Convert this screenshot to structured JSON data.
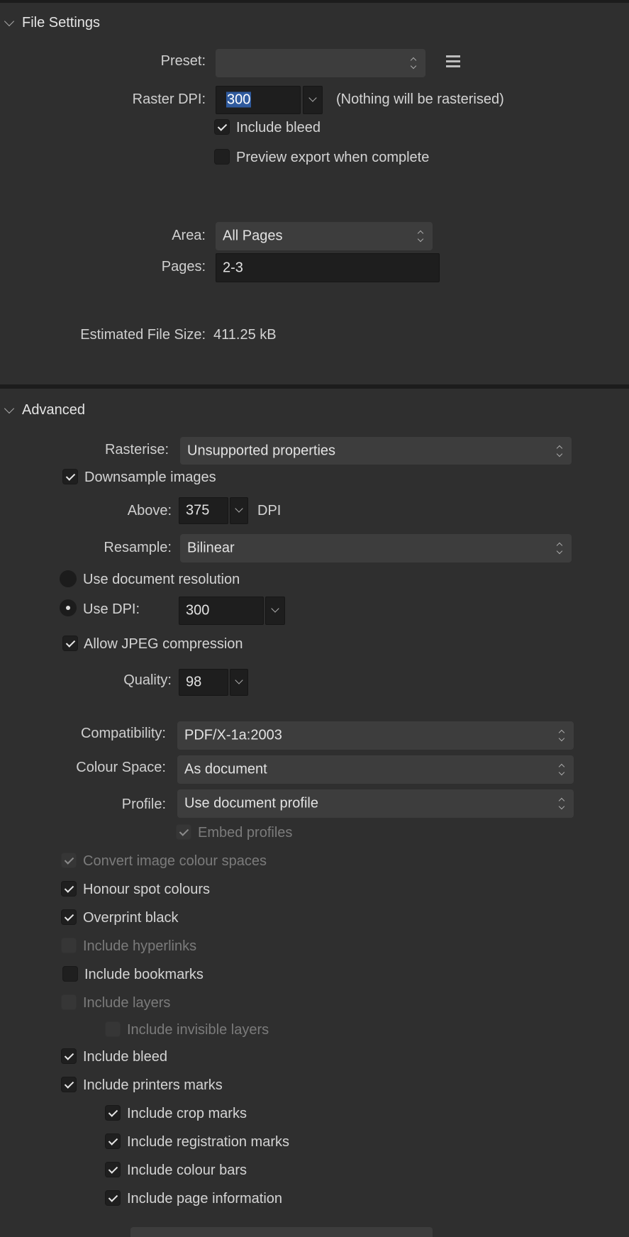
{
  "file_settings": {
    "title": "File Settings",
    "preset_label": "Preset:",
    "preset_value": "",
    "raster_dpi_label": "Raster DPI:",
    "raster_dpi_value": "300",
    "raster_note": "(Nothing will be rasterised)",
    "include_bleed": {
      "label": "Include bleed",
      "checked": true
    },
    "preview_export": {
      "label": "Preview export when complete",
      "checked": false
    },
    "area_label": "Area:",
    "area_value": "All Pages",
    "pages_label": "Pages:",
    "pages_value": "2-3",
    "estimated_label": "Estimated File Size:",
    "estimated_value": "411.25 kB"
  },
  "advanced": {
    "title": "Advanced",
    "rasterise_label": "Rasterise:",
    "rasterise_value": "Unsupported properties",
    "downsample": {
      "label": "Downsample images",
      "checked": true
    },
    "above_label": "Above:",
    "above_value": "375",
    "above_unit": "DPI",
    "resample_label": "Resample:",
    "resample_value": "Bilinear",
    "use_doc_res": {
      "label": "Use document resolution",
      "selected": false
    },
    "use_dpi": {
      "label": "Use DPI:",
      "selected": true,
      "value": "300"
    },
    "allow_jpeg": {
      "label": "Allow JPEG compression",
      "checked": true
    },
    "quality_label": "Quality:",
    "quality_value": "98",
    "compat_label": "Compatibility:",
    "compat_value": "PDF/X-1a:2003",
    "colour_space_label": "Colour Space:",
    "colour_space_value": "As document",
    "profile_label": "Profile:",
    "profile_value": "Use document profile",
    "embed_profiles": {
      "label": "Embed profiles",
      "checked": true,
      "disabled": true
    },
    "convert_colour": {
      "label": "Convert image colour spaces",
      "checked": true,
      "disabled": true
    },
    "honour_spot": {
      "label": "Honour spot colours",
      "checked": true
    },
    "overprint_black": {
      "label": "Overprint black",
      "checked": true
    },
    "include_hyperlinks": {
      "label": "Include hyperlinks",
      "checked": false,
      "disabled": true
    },
    "include_bookmarks": {
      "label": "Include bookmarks",
      "checked": false
    },
    "include_layers": {
      "label": "Include layers",
      "checked": false,
      "disabled": true
    },
    "include_invisible_layers": {
      "label": "Include invisible layers",
      "checked": false,
      "disabled": true
    },
    "include_bleed": {
      "label": "Include bleed",
      "checked": true
    },
    "include_printers_marks": {
      "label": "Include printers marks",
      "checked": true
    },
    "include_crop_marks": {
      "label": "Include crop marks",
      "checked": true
    },
    "include_registration_marks": {
      "label": "Include registration marks",
      "checked": true
    },
    "include_colour_bars": {
      "label": "Include colour bars",
      "checked": true
    },
    "include_page_information": {
      "label": "Include page information",
      "checked": true
    }
  },
  "colors": {
    "panel_bg": "#2f2f2f",
    "field_bg": "#3d3d3d",
    "input_bg": "#1e1e1e",
    "selection": "#2f5a9d"
  }
}
